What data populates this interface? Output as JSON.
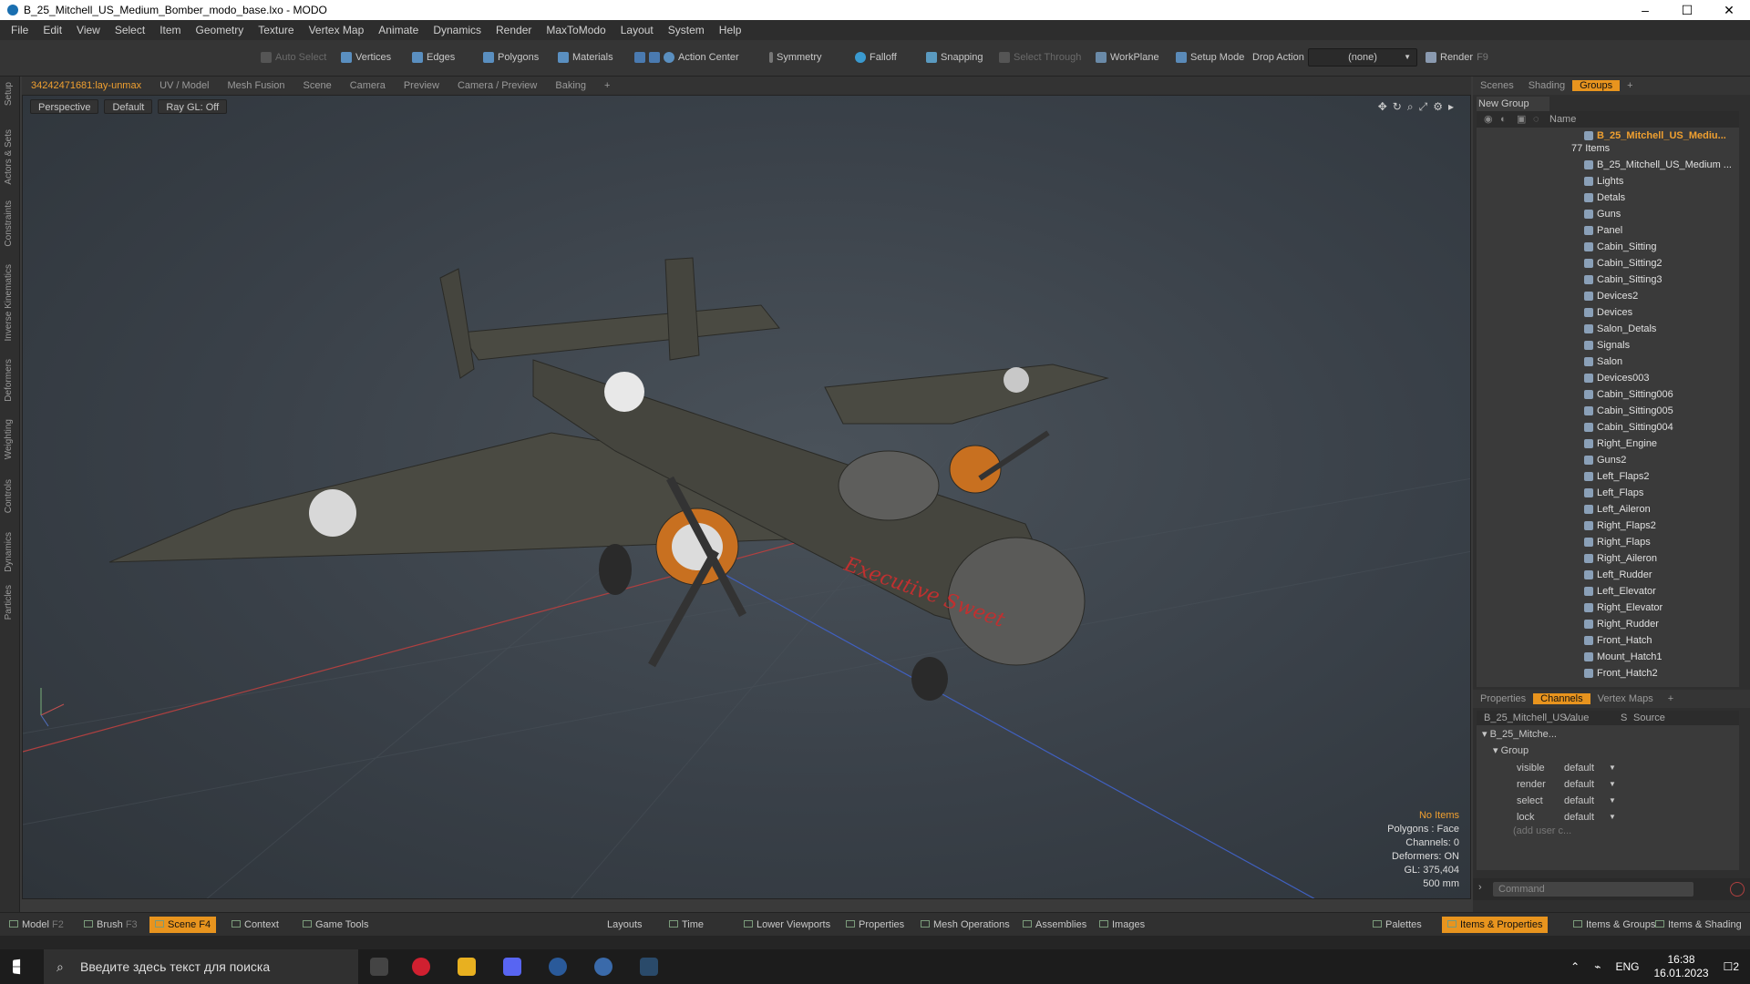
{
  "window": {
    "title": "B_25_Mitchell_US_Medium_Bomber_modo_base.lxo - MODO",
    "min": "–",
    "max": "☐",
    "close": "✕"
  },
  "menu": [
    "File",
    "Edit",
    "View",
    "Select",
    "Item",
    "Geometry",
    "Texture",
    "Vertex Map",
    "Animate",
    "Dynamics",
    "Render",
    "MaxToModo",
    "Layout",
    "System",
    "Help"
  ],
  "toolbar": {
    "auto_select": "Auto Select",
    "vertices": "Vertices",
    "edges": "Edges",
    "polygons": "Polygons",
    "materials": "Materials",
    "action_center": "Action Center",
    "symmetry": "Symmetry",
    "falloff": "Falloff",
    "snapping": "Snapping",
    "select_through": "Select Through",
    "workplane": "WorkPlane",
    "setup_mode": "Setup Mode",
    "drop_action": "Drop Action",
    "drop_value": "(none)",
    "render": "Render",
    "render_key": "F9"
  },
  "left_tabs": [
    "Setup",
    "Actors & Sets",
    "Constraints",
    "Inverse Kinematics",
    "Deformers",
    "Weighting",
    "Controls",
    "Dynamics",
    "Particles"
  ],
  "viewport_tabs": [
    "34242471681:lay-unmax",
    "UV / Model",
    "Mesh Fusion",
    "Scene",
    "Camera",
    "Preview",
    "Camera / Preview",
    "Baking",
    "+"
  ],
  "viewport": {
    "view": "Perspective",
    "shading": "Default",
    "raygl": "Ray GL: Off",
    "nose_art": "Executive Sweet",
    "info": {
      "no_items": "No Items",
      "polygons": "Polygons : Face",
      "channels": "Channels: 0",
      "deformers": "Deformers: ON",
      "gl": "GL: 375,404",
      "scale": "500 mm"
    }
  },
  "right_tabs": [
    "Scenes",
    "Shading",
    "Groups",
    "+"
  ],
  "groups": {
    "new_group": "New Group",
    "name_header": "Name",
    "root": "B_25_Mitchell_US_Mediu...",
    "root_count": "77 Items",
    "items": [
      "B_25_Mitchell_US_Medium ...",
      "Lights",
      "Detals",
      "Guns",
      "Panel",
      "Cabin_Sitting",
      "Cabin_Sitting2",
      "Cabin_Sitting3",
      "Devices2",
      "Devices",
      "Salon_Detals",
      "Signals",
      "Salon",
      "Devices003",
      "Cabin_Sitting006",
      "Cabin_Sitting005",
      "Cabin_Sitting004",
      "Right_Engine",
      "Guns2",
      "Left_Flaps2",
      "Left_Flaps",
      "Left_Aileron",
      "Right_Flaps2",
      "Right_Flaps",
      "Right_Aileron",
      "Left_Rudder",
      "Left_Elevator",
      "Right_Elevator",
      "Right_Rudder",
      "Front_Hatch",
      "Mount_Hatch1",
      "Front_Hatch2"
    ]
  },
  "props_tabs": [
    "Properties",
    "Channels",
    "Vertex Maps",
    "+"
  ],
  "channels": {
    "col_item": "B_25_Mitchell_US ...",
    "col_value": "Value",
    "col_s": "S",
    "col_source": "Source",
    "root": "B_25_Mitche...",
    "group": "Group",
    "rows": [
      {
        "name": "visible",
        "value": "default"
      },
      {
        "name": "render",
        "value": "default"
      },
      {
        "name": "select",
        "value": "default"
      },
      {
        "name": "lock",
        "value": "default"
      }
    ],
    "add": "(add user c..."
  },
  "command": {
    "placeholder": "Command"
  },
  "bottom": {
    "model": "Model",
    "model_key": "F2",
    "brush": "Brush",
    "brush_key": "F3",
    "scene": "Scene",
    "scene_key": "F4",
    "context": "Context",
    "game_tools": "Game Tools",
    "layouts": "Layouts",
    "time": "Time",
    "lower_viewports": "Lower Viewports",
    "properties": "Properties",
    "mesh_operations": "Mesh Operations",
    "assemblies": "Assemblies",
    "images": "Images",
    "palettes": "Palettes",
    "items_properties": "Items & Properties",
    "items_groups": "Items & Groups",
    "items_shading": "Items & Shading"
  },
  "taskbar": {
    "search": "Введите здесь текст для поиска",
    "lang": "ENG",
    "time": "16:38",
    "date": "16.01.2023",
    "notif": "2"
  }
}
